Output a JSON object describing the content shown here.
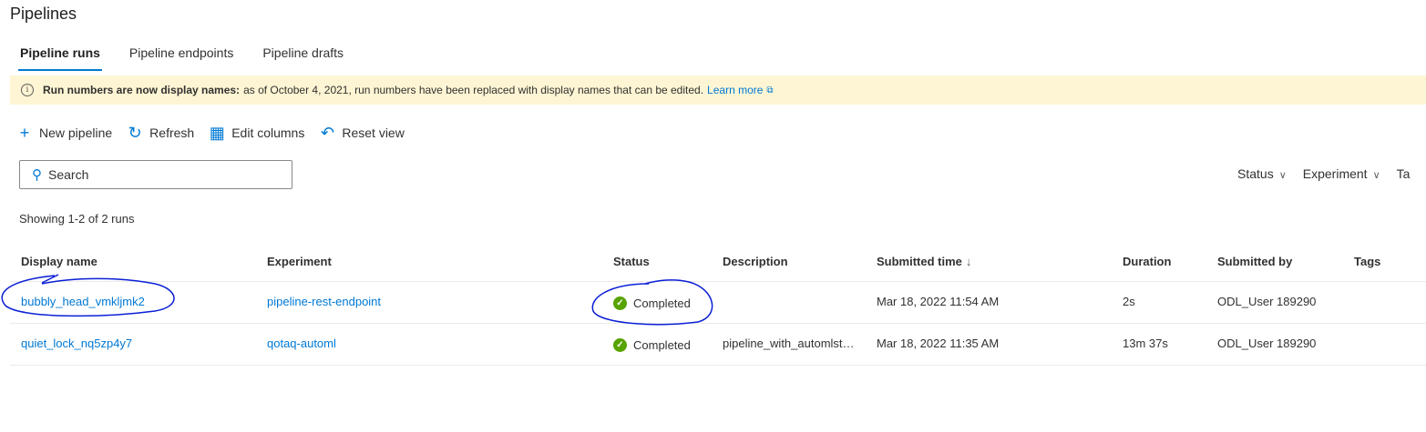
{
  "page": {
    "title": "Pipelines"
  },
  "tabs": [
    {
      "label": "Pipeline runs",
      "active": true
    },
    {
      "label": "Pipeline endpoints",
      "active": false
    },
    {
      "label": "Pipeline drafts",
      "active": false
    }
  ],
  "banner": {
    "icon": "info-icon",
    "bold": "Run numbers are now display names:",
    "text": "as of October 4, 2021, run numbers have been replaced with display names that can be edited.",
    "link": "Learn more",
    "bg_color": "#fdf5d3"
  },
  "toolbar": {
    "new_pipeline": "New pipeline",
    "refresh": "Refresh",
    "edit_columns": "Edit columns",
    "reset_view": "Reset view"
  },
  "search": {
    "placeholder": "Search"
  },
  "filters": [
    {
      "label": "Status"
    },
    {
      "label": "Experiment"
    },
    {
      "label": "Ta"
    }
  ],
  "showing": "Showing 1-2 of 2 runs",
  "table": {
    "columns": {
      "display_name": "Display name",
      "experiment": "Experiment",
      "status": "Status",
      "description": "Description",
      "submitted_time": "Submitted time",
      "duration": "Duration",
      "submitted_by": "Submitted by",
      "tags": "Tags"
    },
    "rows": [
      {
        "display_name": "bubbly_head_vmkljmk2",
        "experiment": "pipeline-rest-endpoint",
        "status": "Completed",
        "description": "",
        "submitted_time": "Mar 18, 2022 11:54 AM",
        "duration": "2s",
        "submitted_by": "ODL_User 189290",
        "tags": ""
      },
      {
        "display_name": "quiet_lock_nq5zp4y7",
        "experiment": "qotaq-automl",
        "status": "Completed",
        "description": "pipeline_with_automlst…",
        "submitted_time": "Mar 18, 2022 11:35 AM",
        "duration": "13m 37s",
        "submitted_by": "ODL_User 189290",
        "tags": ""
      }
    ]
  },
  "colors": {
    "accent": "#0078d4",
    "success": "#57a300",
    "annotation": "#0a1fd6"
  }
}
